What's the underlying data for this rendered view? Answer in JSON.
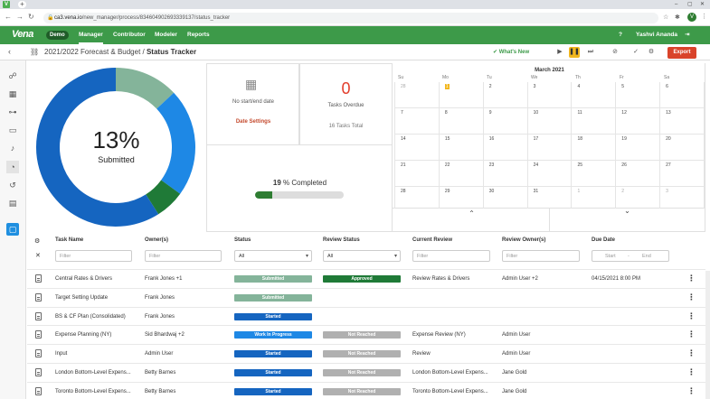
{
  "browser": {
    "tab_icon": "V",
    "new_tab": "+",
    "url_host": "ca3.vena.io",
    "url_path": "/new_manager/process/834604902693339137/status_tracker",
    "profile_initial": "V"
  },
  "app": {
    "logo": "Vena",
    "demo_badge": "Demo",
    "nav": [
      "Manager",
      "Contributor",
      "Modeler",
      "Reports"
    ],
    "user_name": "Yashvi Ananda"
  },
  "toolbar": {
    "crumb_process": "2021/2022 Forecast & Budget",
    "crumb_sep": " / ",
    "crumb_page": "Status Tracker",
    "whats_new": "What's New",
    "export": "Export"
  },
  "summary": {
    "submitted_pct": "13%",
    "submitted_label": "Submitted",
    "donut_segments": [
      {
        "state": "submitted",
        "fraction": 0.13,
        "color": "#84b49a"
      },
      {
        "state": "started",
        "fraction": 0.22,
        "color": "#1e88e5"
      },
      {
        "state": "approved",
        "fraction": 0.06,
        "color": "#1f7a37"
      },
      {
        "state": "not-started",
        "fraction": 0.59,
        "color": "#1565c0"
      }
    ],
    "no_date": "No start/end date",
    "date_settings": "Date Settings",
    "overdue_count": "0",
    "overdue_label": "Tasks Overdue",
    "total_label": "16 Tasks Total",
    "completed_num": "19",
    "completed_label": " % Completed",
    "completed_fraction": 0.19
  },
  "calendar": {
    "title": "March 2021",
    "days": [
      "Su",
      "Mo",
      "Tu",
      "We",
      "Th",
      "Fr",
      "Sa"
    ],
    "weeks": [
      [
        "28",
        "1",
        "2",
        "3",
        "4",
        "5",
        "6"
      ],
      [
        "7",
        "8",
        "9",
        "10",
        "11",
        "12",
        "13"
      ],
      [
        "14",
        "15",
        "16",
        "17",
        "18",
        "19",
        "20"
      ],
      [
        "21",
        "22",
        "23",
        "24",
        "25",
        "26",
        "27"
      ],
      [
        "28",
        "29",
        "30",
        "31",
        "1",
        "2",
        "3"
      ]
    ],
    "today": "1",
    "up_arrow": "⌃",
    "down_arrow": "⌄"
  },
  "table": {
    "headers": {
      "task": "Task Name",
      "owner": "Owner(s)",
      "status": "Status",
      "review_status": "Review Status",
      "current_review": "Current Review",
      "review_owner": "Review Owner(s)",
      "due": "Due Date"
    },
    "filters": {
      "task_placeholder": "Filter",
      "owner_placeholder": "Filter",
      "status_value": "All",
      "review_value": "All",
      "current_placeholder": "Filter",
      "reviewowner_placeholder": "Filter",
      "start": "Start",
      "dash": "-",
      "end": "End"
    },
    "rows": [
      {
        "task": "Central Rates & Drivers",
        "owner": "Frank Jones +1",
        "status": "Submitted",
        "status_color": "#84b49a",
        "review": "Approved",
        "review_color": "#1f7a37",
        "current": "Review Rates & Drivers",
        "review_owner": "Admin User +2",
        "due": "04/15/2021 8:00 PM"
      },
      {
        "task": "Target Setting Update",
        "owner": "Frank Jones",
        "status": "Submitted",
        "status_color": "#84b49a",
        "review": "",
        "review_color": "",
        "current": "",
        "review_owner": "",
        "due": ""
      },
      {
        "task": "BS & CF Plan (Consolidated)",
        "owner": "Frank Jones",
        "status": "Started",
        "status_color": "#1565c0",
        "review": "",
        "review_color": "",
        "current": "",
        "review_owner": "",
        "due": ""
      },
      {
        "task": "Expense Planning (NY)",
        "owner": "Sid Bhardwaj +2",
        "status": "Work In Progress",
        "status_color": "#1e88e5",
        "review": "Not Reached",
        "review_color": "#b0b0b0",
        "current": "Expense Review (NY)",
        "review_owner": "Admin User",
        "due": ""
      },
      {
        "task": "Input",
        "owner": "Admin User",
        "status": "Started",
        "status_color": "#1565c0",
        "review": "Not Reached",
        "review_color": "#b0b0b0",
        "current": "Review",
        "review_owner": "Admin User",
        "due": ""
      },
      {
        "task": "London Bottom-Level Expens...",
        "owner": "Betty Barnes",
        "status": "Started",
        "status_color": "#1565c0",
        "review": "Not Reached",
        "review_color": "#b0b0b0",
        "current": "London Bottom-Level Expens...",
        "review_owner": "Jane Gold",
        "due": ""
      },
      {
        "task": "Toronto Bottom-Level Expens...",
        "owner": "Betty Barnes",
        "status": "Started",
        "status_color": "#1565c0",
        "review": "Not Reached",
        "review_color": "#b0b0b0",
        "current": "Toronto Bottom-Level Expens...",
        "review_owner": "Jane Gold",
        "due": ""
      }
    ]
  }
}
